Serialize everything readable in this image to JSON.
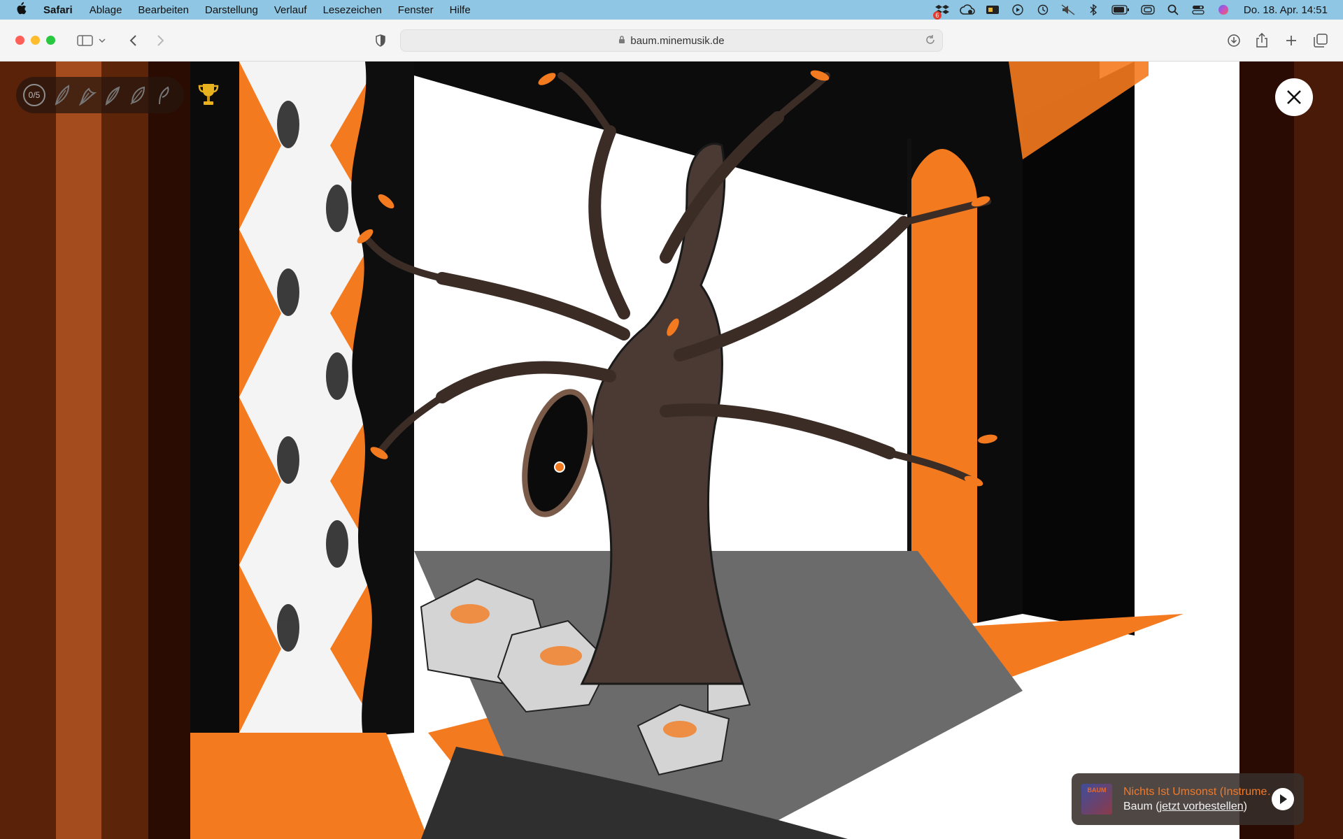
{
  "menubar": {
    "app_name": "Safari",
    "items": [
      "Ablage",
      "Bearbeiten",
      "Darstellung",
      "Verlauf",
      "Lesezeichen",
      "Fenster",
      "Hilfe"
    ],
    "status_icons": [
      "dropbox-icon",
      "cloud-sync-icon",
      "app-icon",
      "play-icon",
      "time-machine-icon",
      "mute-icon",
      "bluetooth-icon",
      "battery-icon",
      "screen-mirroring-icon",
      "search-icon",
      "control-center-icon",
      "siri-icon"
    ],
    "notification_badge": "6",
    "clock": "Do. 18. Apr.  14:51",
    "bg_color": "#8fc6e3"
  },
  "browser": {
    "url": "baum.minemusik.de",
    "traffic_colors": [
      "#ff5f57",
      "#febc2e",
      "#28c840"
    ]
  },
  "page": {
    "leaf_counter": "0/5",
    "leaf_icons": [
      "leaf-1-icon",
      "leaf-2-icon",
      "leaf-3-icon",
      "leaf-4-icon",
      "leaf-5-icon"
    ],
    "accent": "#f47a1f"
  },
  "player": {
    "album_art_text": "BAUM",
    "track_title": "Nichts Ist Umsonst (Instrumental)",
    "artist": "Baum",
    "artist_link_prefix": " (",
    "artist_link": "jetzt vorbestellen",
    "artist_link_suffix": ")"
  }
}
